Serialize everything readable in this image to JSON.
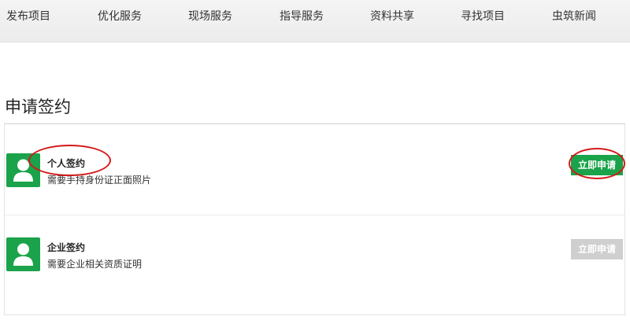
{
  "nav": {
    "items": [
      {
        "label": "发布项目"
      },
      {
        "label": "优化服务"
      },
      {
        "label": "现场服务"
      },
      {
        "label": "指导服务"
      },
      {
        "label": "资料共享"
      },
      {
        "label": "寻找项目"
      },
      {
        "label": "虫筑新闻"
      }
    ]
  },
  "page": {
    "title": "申请签约"
  },
  "options": [
    {
      "title": "个人签约",
      "description": "需要手持身份证正面照片",
      "button_label": "立即申请",
      "button_state": "active",
      "icon": "user-avatar-icon"
    },
    {
      "title": "企业签约",
      "description": "需要企业相关资质证明",
      "button_label": "立即申请",
      "button_state": "disabled",
      "icon": "user-avatar-icon"
    }
  ],
  "colors": {
    "accent": "#1aa34a",
    "disabled": "#cfcfcf",
    "annotation": "#d41818"
  }
}
